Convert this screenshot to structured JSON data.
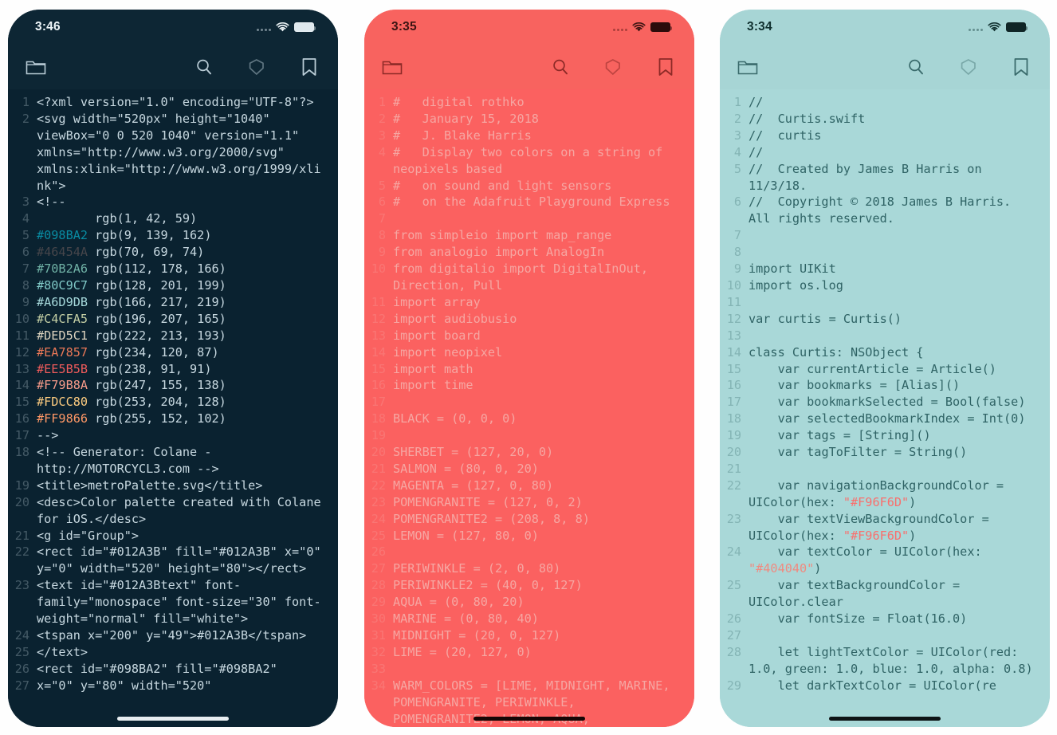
{
  "app": {
    "name": "code-editor-viewer"
  },
  "background_color": "#fefefe",
  "phones": [
    {
      "id": "phone-navy",
      "theme_name": "navy",
      "background_color": "#0a2230",
      "navbar_color": "#0d2634",
      "text_color": "#c7d8e0",
      "statusbar": {
        "time": "3:46",
        "signal": "cellular-dots",
        "wifi": "wifi-icon",
        "battery": "battery-icon"
      },
      "navbar": {
        "folder_label": "folder-icon",
        "search_label": "search-icon",
        "tag_label": "tag-icon",
        "bookmark_label": "bookmark-icon"
      },
      "lines": [
        {
          "n": "1",
          "t": "<?xml version=\"1.0\" encoding=\"UTF-8\"?>"
        },
        {
          "n": "2",
          "t": "<svg width=\"520px\" height=\"1040\" viewBox=\"0 0 520 1040\" version=\"1.1\" xmlns=\"http://www.w3.org/2000/svg\" xmlns:xlink=\"http://www.w3.org/1999/xlink\">"
        },
        {
          "n": "3",
          "t": "<!--"
        },
        {
          "n": "4",
          "t": "        rgb(1, 42, 59)"
        },
        {
          "n": "5",
          "t": "#098BA2 rgb(9, 139, 162)",
          "hex": "#098BA2"
        },
        {
          "n": "6",
          "t": "#46454A rgb(70, 69, 74)",
          "hex": "#46454A"
        },
        {
          "n": "7",
          "t": "#70B2A6 rgb(112, 178, 166)",
          "hex": "#70B2A6"
        },
        {
          "n": "8",
          "t": "#80C9C7 rgb(128, 201, 199)",
          "hex": "#80C9C7"
        },
        {
          "n": "9",
          "t": "#A6D9DB rgb(166, 217, 219)",
          "hex": "#A6D9DB"
        },
        {
          "n": "10",
          "t": "#C4CFA5 rgb(196, 207, 165)",
          "hex": "#C4CFA5"
        },
        {
          "n": "11",
          "t": "#DED5C1 rgb(222, 213, 193)",
          "hex": "#DED5C1"
        },
        {
          "n": "12",
          "t": "#EA7857 rgb(234, 120, 87)",
          "hex": "#EA7857"
        },
        {
          "n": "13",
          "t": "#EE5B5B rgb(238, 91, 91)",
          "hex": "#EE5B5B"
        },
        {
          "n": "14",
          "t": "#F79B8A rgb(247, 155, 138)",
          "hex": "#F79B8A"
        },
        {
          "n": "15",
          "t": "#FDCC80 rgb(253, 204, 128)",
          "hex": "#FDCC80"
        },
        {
          "n": "16",
          "t": "#FF9866 rgb(255, 152, 102)",
          "hex": "#FF9866"
        },
        {
          "n": "17",
          "t": "-->"
        },
        {
          "n": "18",
          "t": "<!-- Generator: Colane - http://MOTORCYCL3.com -->"
        },
        {
          "n": "19",
          "t": "<title>metroPalette.svg</title>"
        },
        {
          "n": "20",
          "t": "<desc>Color palette created with Colane for iOS.</desc>"
        },
        {
          "n": "21",
          "t": "<g id=\"Group\">"
        },
        {
          "n": "22",
          "t": "<rect id=\"#012A3B\" fill=\"#012A3B\" x=\"0\" y=\"0\" width=\"520\" height=\"80\"></rect>"
        },
        {
          "n": "23",
          "t": "<text id=\"#012A3Btext\" font-family=\"monospace\" font-size=\"30\" font-weight=\"normal\" fill=\"white\">"
        },
        {
          "n": "24",
          "t": "<tspan x=\"200\" y=\"49\">#012A3B</tspan>"
        },
        {
          "n": "25",
          "t": "</text>"
        },
        {
          "n": "26",
          "t": "<rect id=\"#098BA2\" fill=\"#098BA2\""
        },
        {
          "n": "27",
          "t": "x=\"0\" y=\"80\" width=\"520\""
        }
      ]
    },
    {
      "id": "phone-coral",
      "theme_name": "coral",
      "background_color": "#fb6160",
      "navbar_color": "#f8635f",
      "text_color": "#f6a6a2",
      "statusbar": {
        "time": "3:35",
        "signal": "cellular-dots",
        "wifi": "wifi-icon",
        "battery": "battery-icon"
      },
      "navbar": {
        "folder_label": "folder-icon",
        "search_label": "search-icon",
        "tag_label": "tag-icon",
        "bookmark_label": "bookmark-icon"
      },
      "lines": [
        {
          "n": "1",
          "t": "#   digital rothko"
        },
        {
          "n": "2",
          "t": "#   January 15, 2018"
        },
        {
          "n": "3",
          "t": "#   J. Blake Harris"
        },
        {
          "n": "4",
          "t": "#   Display two colors on a string of neopixels based"
        },
        {
          "n": "5",
          "t": "#   on sound and light sensors"
        },
        {
          "n": "6",
          "t": "#   on the Adafruit Playground Express"
        },
        {
          "n": "7",
          "t": ""
        },
        {
          "n": "8",
          "t": "from simpleio import map_range"
        },
        {
          "n": "9",
          "t": "from analogio import AnalogIn"
        },
        {
          "n": "10",
          "t": "from digitalio import DigitalInOut, Direction, Pull"
        },
        {
          "n": "11",
          "t": "import array"
        },
        {
          "n": "12",
          "t": "import audiobusio"
        },
        {
          "n": "13",
          "t": "import board"
        },
        {
          "n": "14",
          "t": "import neopixel"
        },
        {
          "n": "15",
          "t": "import math"
        },
        {
          "n": "16",
          "t": "import time"
        },
        {
          "n": "17",
          "t": ""
        },
        {
          "n": "18",
          "t": "BLACK = (0, 0, 0)"
        },
        {
          "n": "19",
          "t": ""
        },
        {
          "n": "20",
          "t": "SHERBET = (127, 20, 0)"
        },
        {
          "n": "21",
          "t": "SALMON = (80, 0, 20)"
        },
        {
          "n": "22",
          "t": "MAGENTA = (127, 0, 80)"
        },
        {
          "n": "23",
          "t": "POMENGRANITE = (127, 0, 2)"
        },
        {
          "n": "24",
          "t": "POMENGRANITE2 = (208, 8, 8)"
        },
        {
          "n": "25",
          "t": "LEMON = (127, 80, 0)"
        },
        {
          "n": "26",
          "t": ""
        },
        {
          "n": "27",
          "t": "PERIWINKLE = (2, 0, 80)"
        },
        {
          "n": "28",
          "t": "PERIWINKLE2 = (40, 0, 127)"
        },
        {
          "n": "29",
          "t": "AQUA = (0, 80, 20)"
        },
        {
          "n": "30",
          "t": "MARINE = (0, 80, 40)"
        },
        {
          "n": "31",
          "t": "MIDNIGHT = (20, 0, 127)"
        },
        {
          "n": "32",
          "t": "LIME = (20, 127, 0)"
        },
        {
          "n": "33",
          "t": ""
        },
        {
          "n": "34",
          "t": "WARM_COLORS = [LIME, MIDNIGHT, MARINE, POMENGRANITE, PERIWINKLE, POMENGRANITE2, LEMON, AQUA,"
        }
      ]
    },
    {
      "id": "phone-teal",
      "theme_name": "teal",
      "background_color": "#a9d8d8",
      "navbar_color": "#a7d5d5",
      "text_color": "#2f6365",
      "statusbar": {
        "time": "3:34",
        "signal": "cellular-dots",
        "wifi": "wifi-icon",
        "battery": "battery-icon"
      },
      "navbar": {
        "folder_label": "folder-icon",
        "search_label": "search-icon",
        "tag_label": "tag-icon",
        "bookmark_label": "bookmark-icon"
      },
      "lines": [
        {
          "n": "1",
          "t": "//"
        },
        {
          "n": "2",
          "t": "//  Curtis.swift"
        },
        {
          "n": "3",
          "t": "//  curtis"
        },
        {
          "n": "4",
          "t": "//"
        },
        {
          "n": "5",
          "t": "//  Created by James B Harris on 11/3/18."
        },
        {
          "n": "6",
          "t": "//  Copyright © 2018 James B Harris. All rights reserved."
        },
        {
          "n": "7",
          "t": ""
        },
        {
          "n": "8",
          "t": ""
        },
        {
          "n": "9",
          "t": "import UIKit"
        },
        {
          "n": "10",
          "t": "import os.log"
        },
        {
          "n": "11",
          "t": ""
        },
        {
          "n": "12",
          "t": "var curtis = Curtis()"
        },
        {
          "n": "13",
          "t": ""
        },
        {
          "n": "14",
          "t": "class Curtis: NSObject {"
        },
        {
          "n": "15",
          "t": "    var currentArticle = Article()"
        },
        {
          "n": "16",
          "t": "    var bookmarks = [Alias]()"
        },
        {
          "n": "17",
          "t": "    var bookmarkSelected = Bool(false)"
        },
        {
          "n": "18",
          "t": "    var selectedBookmarkIndex = Int(0)"
        },
        {
          "n": "19",
          "t": "    var tags = [String]()"
        },
        {
          "n": "20",
          "t": "    var tagToFilter = String()"
        },
        {
          "n": "21",
          "t": ""
        },
        {
          "n": "22",
          "t": "    var navigationBackgroundColor = UIColor(hex: \"#F96F6D\")",
          "hex_token": "\"#F96F6D\"",
          "hex": "#F96F6D"
        },
        {
          "n": "23",
          "t": "    var textViewBackgroundColor = UIColor(hex: \"#F96F6D\")",
          "hex_token": "\"#F96F6D\"",
          "hex": "#F96F6D"
        },
        {
          "n": "24",
          "t": "    var textColor = UIColor(hex: \"#404040\")",
          "hex_token": "\"#404040\"",
          "hex": "#F08A80"
        },
        {
          "n": "25",
          "t": "    var textBackgroundColor = UIColor.clear"
        },
        {
          "n": "26",
          "t": "    var fontSize = Float(16.0)"
        },
        {
          "n": "27",
          "t": ""
        },
        {
          "n": "28",
          "t": "    let lightTextColor = UIColor(red: 1.0, green: 1.0, blue: 1.0, alpha: 0.8)"
        },
        {
          "n": "29",
          "t": "    let darkTextColor = UIColor(re"
        }
      ]
    }
  ]
}
